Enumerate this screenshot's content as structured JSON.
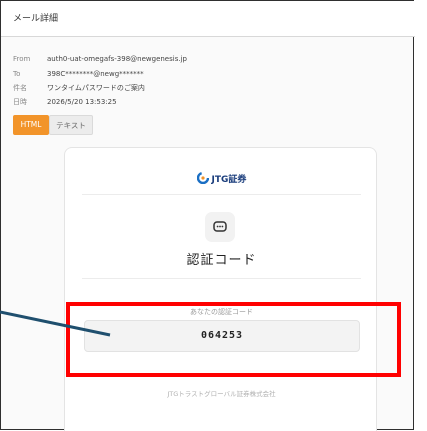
{
  "window": {
    "title": "メール詳細"
  },
  "meta": {
    "from_label": "From",
    "from_value": "auth0-uat-omegafs-398@newgenesis.jp",
    "to_label": "To",
    "to_value": "398C********@newg*******",
    "subject_label": "件名",
    "subject_value": "ワンタイムパスワードのご案内",
    "date_label": "日時",
    "date_value": "2026/5/20 13:53:25"
  },
  "tabs": [
    {
      "label": "HTML",
      "active": true
    },
    {
      "label": "テキスト",
      "active": false
    }
  ],
  "email": {
    "logo_text": "JTG証券",
    "logo_icon": "jtg-logo-icon",
    "title": "認証コード",
    "code_label": "あなたの認証コード",
    "code": "064253",
    "footer": "JTGトラストグローバル証券株式会社",
    "message_icon": "message-icon"
  },
  "annotation": {
    "highlight_color": "#ff0000",
    "pointer_color": "#1f4f6e"
  },
  "colors": {
    "tab_active": "#f2942a",
    "brand": "#1a3d7c"
  }
}
